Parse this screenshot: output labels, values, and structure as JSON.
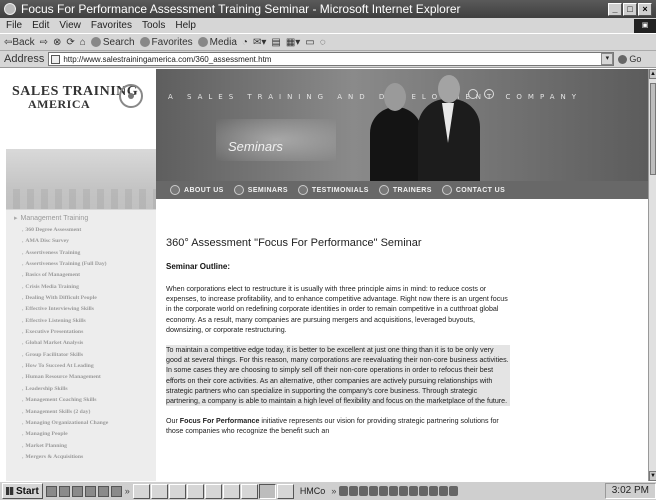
{
  "window": {
    "title": "Focus For Performance Assessment Training Seminar - Microsoft Internet Explorer",
    "minimize": "_",
    "maximize": "□",
    "close": "×"
  },
  "menu": [
    "File",
    "Edit",
    "View",
    "Favorites",
    "Tools",
    "Help"
  ],
  "toolbar": {
    "back": "⇦Back",
    "forward": "⇨",
    "search": "Search",
    "favorites": "Favorites",
    "media": "Media"
  },
  "address": {
    "label": "Address",
    "url": "http://www.salestrainingamerica.com/360_assessment.htm",
    "go": "Go"
  },
  "site": {
    "logo_line1": "SALES TRAINING",
    "logo_line2": "AMERICA",
    "tagline": "A SALES TRAINING AND DEVELOPMENT COMPANY",
    "banner_word": "Seminars",
    "nav": [
      "ABOUT US",
      "SEMINARS",
      "TESTIMONIALS",
      "TRAINERS",
      "CONTACT US"
    ]
  },
  "sidebar": {
    "title": "Management Training",
    "items": [
      "360 Degree Assessment",
      "AMA Disc Survey",
      "Assertiveness Training",
      "Assertiveness Training (Full Day)",
      "Basics of Management",
      "Crisis Media Training",
      "Dealing With Difficult People",
      "Effective Interviewing Skills",
      "Effective Listening Skills",
      "Executive Presentations",
      "Global Market Analysis",
      "Group Facilitator Skills",
      "How To Succeed At Leading",
      "Human Resource Management",
      "Leadership Skills",
      "Management Coaching Skills",
      "Management Skills (2 day)",
      "Managing Organizational Change",
      "Managing People",
      "Market Planning",
      "Mergers & Acquisitions"
    ]
  },
  "main": {
    "title": "360° Assessment \"Focus For Performance\" Seminar",
    "section": "Seminar Outline:",
    "para1": "When corporations elect to restructure it is usually with three principle aims in mind: to reduce costs or expenses, to increase profitability, and to enhance competitive advantage. Right now there is an urgent focus in the corporate world on redefining corporate identities in order to remain competitive in a cutthroat global economy. As a result, many companies are pursuing mergers and acquisitions, leveraged buyouts, downsizing, or corporate restructuring.",
    "para2": "To maintain a competitive edge today, it is better to be excellent at just one thing than it is to be only very good at several things. For this reason, many corporations are reevaluating their non-core business activities. In some cases they are choosing to simply sell off their non-core operations in order to refocus their best efforts on their core activities. As an alternative, other companies are actively pursuing relationships with strategic partners who can specialize in supporting the company's core business. Through strategic partnering, a company is able to maintain a high level of flexibility and focus on the marketplace of the future.",
    "para3_pre": "Our ",
    "para3_bold": "Focus For Performance",
    "para3_post": " initiative represents our vision for providing strategic partnering solutions for those companies who recognize the benefit such an"
  },
  "taskbar": {
    "start": "Start",
    "task_label": "HMCo",
    "clock": "3:02 PM"
  }
}
